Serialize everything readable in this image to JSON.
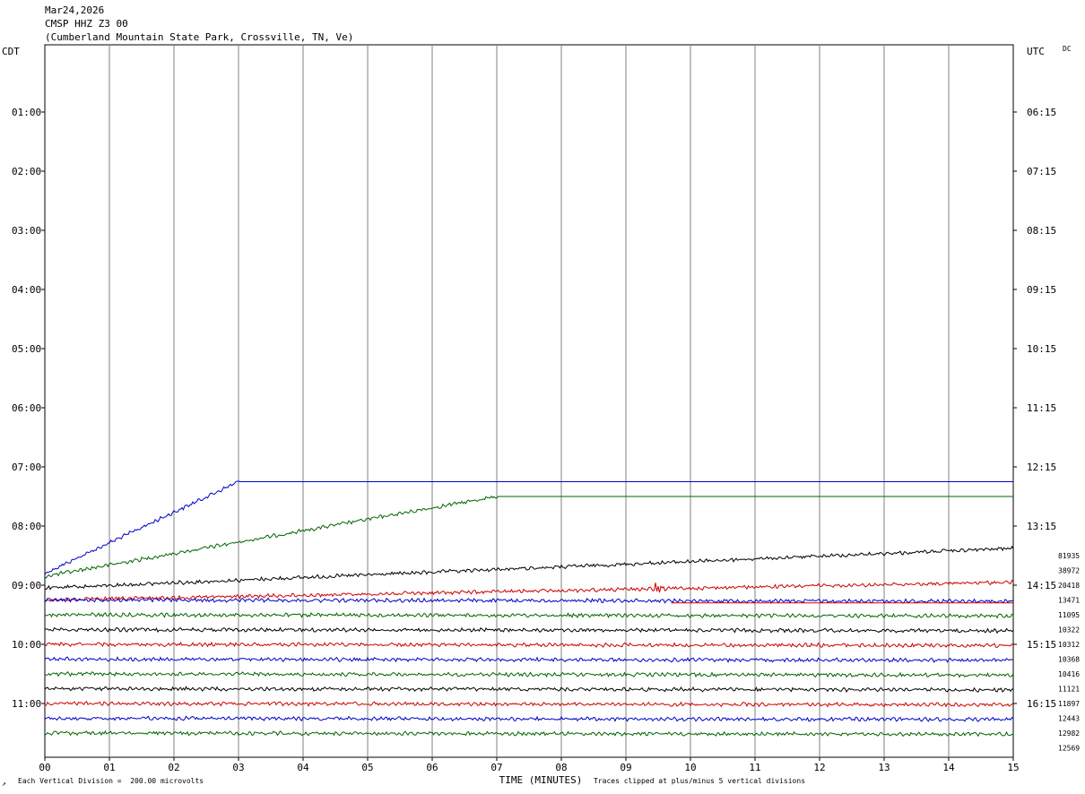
{
  "header": {
    "date": "Mar24,2026",
    "station": "CMSP HHZ Z3 00",
    "location": "(Cumberland Mountain State Park, Crossville, TN, Ve)"
  },
  "labels": {
    "left_zone": "CDT",
    "right_zone": "UTC",
    "dc": "DC",
    "x_axis": "TIME (MINUTES)",
    "scale_note": "Each Vertical Division =  200.00 microvolts",
    "clip_note": "Traces clipped at plus/minus 5 vertical divisions",
    "corner_mark": "↗"
  },
  "chart_data": {
    "type": "line",
    "title": "CMSP HHZ Z3 00",
    "xlabel": "TIME (MINUTES)",
    "xlim": [
      0,
      15
    ],
    "x_ticks": [
      "00",
      "01",
      "02",
      "03",
      "04",
      "05",
      "06",
      "07",
      "08",
      "09",
      "10",
      "11",
      "12",
      "13",
      "14",
      "15"
    ],
    "row_minutes": 15,
    "left_time_labels": [
      {
        "row": 4,
        "label": "01:00"
      },
      {
        "row": 8,
        "label": "02:00"
      },
      {
        "row": 12,
        "label": "03:00"
      },
      {
        "row": 16,
        "label": "04:00"
      },
      {
        "row": 20,
        "label": "05:00"
      },
      {
        "row": 24,
        "label": "06:00"
      },
      {
        "row": 28,
        "label": "07:00"
      },
      {
        "row": 32,
        "label": "08:00"
      },
      {
        "row": 36,
        "label": "09:00"
      },
      {
        "row": 40,
        "label": "10:00"
      },
      {
        "row": 44,
        "label": "11:00"
      }
    ],
    "right_time_labels": [
      {
        "row": 4,
        "label": "06:15"
      },
      {
        "row": 8,
        "label": "07:15"
      },
      {
        "row": 12,
        "label": "08:15"
      },
      {
        "row": 16,
        "label": "09:15"
      },
      {
        "row": 20,
        "label": "10:15"
      },
      {
        "row": 24,
        "label": "11:15"
      },
      {
        "row": 28,
        "label": "12:15"
      },
      {
        "row": 32,
        "label": "13:15"
      },
      {
        "row": 36,
        "label": "14:15"
      },
      {
        "row": 40,
        "label": "15:15"
      },
      {
        "row": 44,
        "label": "16:15"
      }
    ],
    "series_colors": [
      "#000000",
      "#cc0000",
      "#0000cc",
      "#006600"
    ],
    "traces": [
      {
        "row": 29,
        "color": "#0000cc",
        "kind": "ramp",
        "ramp_end_min": 3.0,
        "ramp_start_row": 35.2,
        "flat_row": 29.0,
        "amp": 2
      },
      {
        "row": 30,
        "color": "#006600",
        "kind": "ramp",
        "ramp_end_min": 7.0,
        "ramp_start_row": 35.4,
        "flat_row": 30.0,
        "amp": 2
      },
      {
        "row": 31,
        "color": "#000000",
        "kind": "ramp",
        "ramp_end_min": 15.0,
        "ramp_start_row": 36.2,
        "flat_row": 33.5,
        "amp": 2
      },
      {
        "row": 36,
        "color": "#cc0000",
        "kind": "ramp",
        "ramp_end_min": 15.0,
        "ramp_start_row": 37.0,
        "flat_row": 35.8,
        "amp": 2,
        "event_min": 9.45,
        "event_amp": 10
      },
      {
        "row": 37,
        "color": "#0000cc",
        "kind": "noise",
        "amp": 2
      },
      {
        "row": 38,
        "color": "#006600",
        "kind": "noise",
        "amp": 2
      },
      {
        "row": 39,
        "color": "#000000",
        "kind": "noise",
        "amp": 2
      },
      {
        "row": 40,
        "color": "#cc0000",
        "kind": "noise",
        "amp": 2
      },
      {
        "row": 41,
        "color": "#0000cc",
        "kind": "noise",
        "amp": 2
      },
      {
        "row": 42,
        "color": "#006600",
        "kind": "noise",
        "amp": 2
      },
      {
        "row": 43,
        "color": "#000000",
        "kind": "noise",
        "amp": 2
      },
      {
        "row": 44,
        "color": "#cc0000",
        "kind": "noise",
        "amp": 2
      },
      {
        "row": 45,
        "color": "#0000cc",
        "kind": "noise",
        "amp": 2
      },
      {
        "row": 46,
        "color": "#006600",
        "kind": "noise",
        "amp": 2
      }
    ],
    "right_values": [
      "81935",
      "38972",
      "20418",
      "13471",
      "11095",
      "10322",
      "10312",
      "10368",
      "10416",
      "11121",
      "11897",
      "12443",
      "12982",
      "12569"
    ]
  }
}
